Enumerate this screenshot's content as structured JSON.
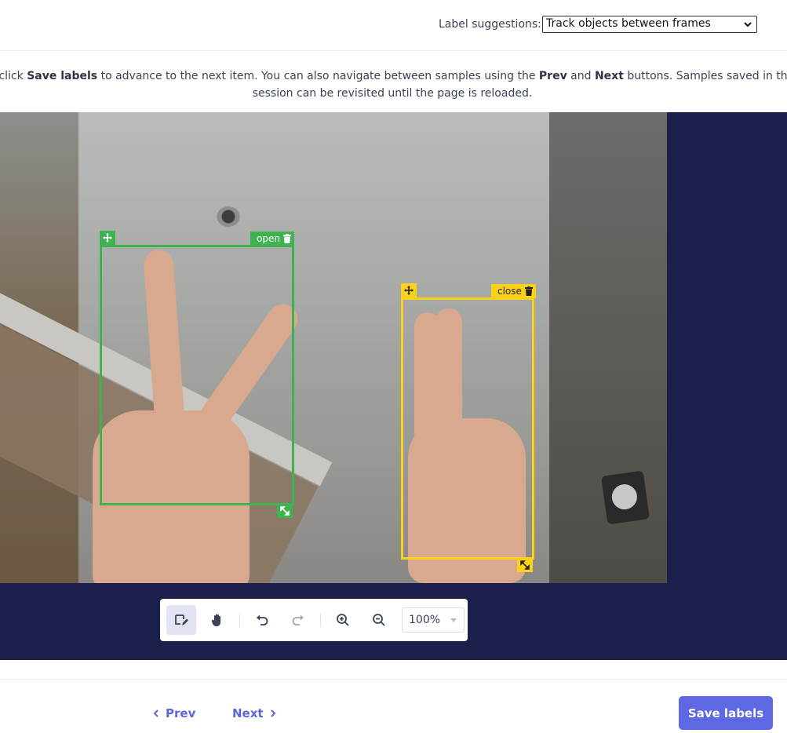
{
  "header": {
    "suggestions_label": "Label suggestions:",
    "suggestions_value": "Track objects between frames"
  },
  "instructions": {
    "prefix": "n click ",
    "save_bold": "Save labels",
    "middle": " to advance to the next item. You can also navigate between samples using the ",
    "prev_bold": "Prev",
    "and": " and ",
    "next_bold": "Next",
    "suffix": " buttons. Samples saved in this session can be revisited until the page is reloaded."
  },
  "annotations": [
    {
      "label": "open",
      "color": "#3fb34f"
    },
    {
      "label": "close",
      "color": "#fad21a"
    }
  ],
  "toolbar": {
    "zoom_value": "100%",
    "tools": [
      "draw-box-icon",
      "pan-hand-icon",
      "undo-icon",
      "redo-icon",
      "zoom-in-icon",
      "zoom-out-icon"
    ]
  },
  "footer": {
    "prev_label": "Prev",
    "next_label": "Next",
    "save_label": "Save labels"
  },
  "colors": {
    "accent": "#5e68e3",
    "stage_bg": "#1c1e4c"
  }
}
